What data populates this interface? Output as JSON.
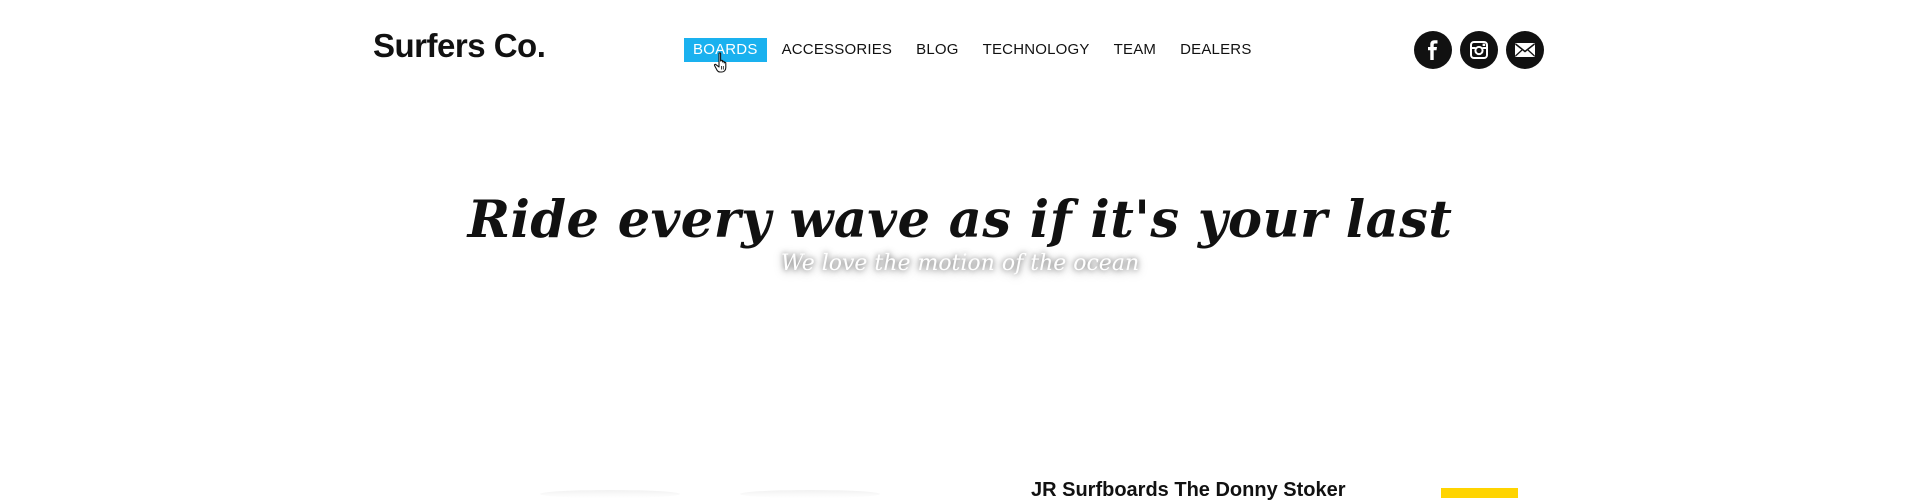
{
  "brand": {
    "logo_text": "Surfers Co."
  },
  "nav": {
    "items": [
      {
        "label": "BOARDS",
        "active": true
      },
      {
        "label": "ACCESSORIES",
        "active": false
      },
      {
        "label": "BLOG",
        "active": false
      },
      {
        "label": "TECHNOLOGY",
        "active": false
      },
      {
        "label": "TEAM",
        "active": false
      },
      {
        "label": "DEALERS",
        "active": false
      }
    ]
  },
  "social": {
    "icons": [
      "facebook-icon",
      "instagram-icon",
      "mail-icon"
    ]
  },
  "hero": {
    "title": "Ride every wave as if it's your last",
    "subtitle": "We love the motion of the ocean"
  },
  "product": {
    "title": "JR Surfboards The Donny Stoker"
  },
  "colors": {
    "nav_active_bg": "#1ab1ef",
    "accent_yellow": "#ffd400",
    "text": "#111111"
  }
}
